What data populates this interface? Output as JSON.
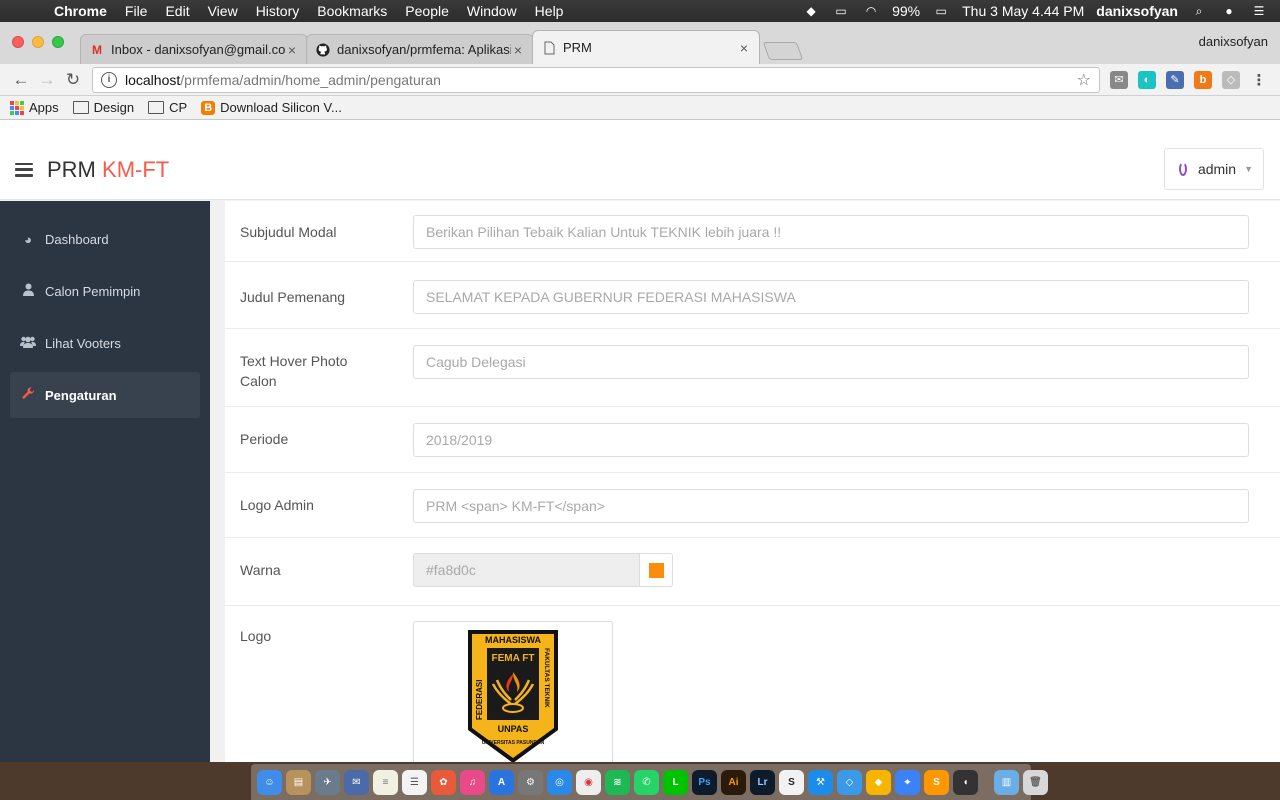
{
  "menubar": {
    "app_name": "Chrome",
    "items": [
      "File",
      "Edit",
      "View",
      "History",
      "Bookmarks",
      "People",
      "Window",
      "Help"
    ],
    "battery": "99%",
    "datetime": "Thu 3 May  4.44 PM",
    "username": "danixsofyan"
  },
  "browser": {
    "tabs": [
      {
        "title": "Inbox - danixsofyan@gmail.com",
        "icon": "gmail-icon"
      },
      {
        "title": "danixsofyan/prmfema: Aplikasi",
        "icon": "github-icon"
      },
      {
        "title": "PRM",
        "icon": "page-icon"
      }
    ],
    "profile_name": "danixsofyan",
    "url_host": "localhost",
    "url_path": "/prmfema/admin/home_admin/pengaturan",
    "bookmarks": [
      "Apps",
      "Design",
      "CP",
      "Download Silicon V..."
    ]
  },
  "app": {
    "brand_main": "PRM",
    "brand_accent": "KM-FT",
    "brand_accent_color": "#fa5a4a",
    "user": "admin"
  },
  "sidebar": {
    "items": [
      {
        "label": "Dashboard",
        "icon": "dashboard-icon"
      },
      {
        "label": "Calon Pemimpin",
        "icon": "user-icon"
      },
      {
        "label": "Lihat Vooters",
        "icon": "users-icon"
      },
      {
        "label": "Pengaturan",
        "icon": "wrench-icon",
        "active": true
      }
    ]
  },
  "form": {
    "subjudul_modal": {
      "label": "Subjudul Modal",
      "value": "Berikan Pilihan Tebaik Kalian Untuk TEKNIK lebih juara !!"
    },
    "judul_pemenang": {
      "label": "Judul Pemenang",
      "value": "SELAMAT KEPADA GUBERNUR FEDERASI MAHASISWA"
    },
    "text_hover": {
      "label": "Text Hover Photo Calon",
      "value": "Cagub Delegasi"
    },
    "periode": {
      "label": "Periode",
      "value": "2018/2019"
    },
    "logo_admin": {
      "label": "Logo Admin",
      "value": "PRM <span> KM-FT</span>"
    },
    "warna": {
      "label": "Warna",
      "value": "#fa8d0c"
    },
    "logo": {
      "label": "Logo",
      "image_text": {
        "top": "MAHASISWA",
        "middle": "FEMA FT",
        "left": "FEDERASI",
        "right": "FAKULTAS TEKNIK",
        "bottom": "UNPAS",
        "arc": "UNIVERSITAS PASUNDAN"
      }
    }
  }
}
